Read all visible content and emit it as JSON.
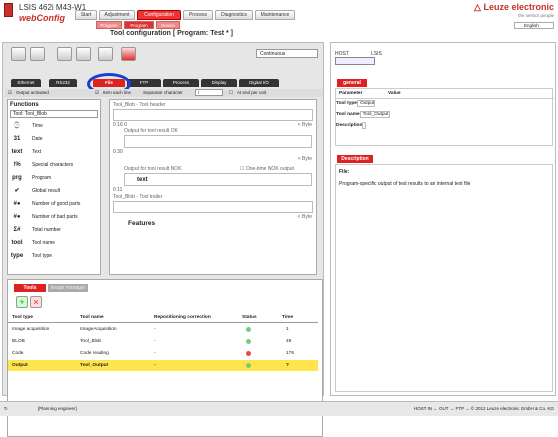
{
  "header": {
    "device": "LSIS 462i M43-W1",
    "app": "webConfig",
    "brand": "△ Leuze electronic",
    "brand_sub": "the sensor people",
    "language": "English",
    "tabs": [
      "Start",
      "Adjustment",
      "Configuration",
      "Process",
      "Diagnostics",
      "Maintenance"
    ],
    "subtabs": [
      "Program",
      "Program",
      "Device"
    ],
    "page_title": "Tool configuration  [ Program: Test * ]"
  },
  "toolbar": {
    "mode": "Continuous"
  },
  "param_tabs": [
    "Ethernet",
    "RS232",
    "File",
    "FTP",
    "Process",
    "Display",
    "Digital I/O"
  ],
  "options": {
    "output_activated": "Output activated",
    "item_each_line": "Item each line",
    "separator_label": "Separator character",
    "separator_value": "/",
    "at_end": "At end per unit"
  },
  "functions": {
    "heading": "Functions",
    "selected": "Tool: Tool_Blob",
    "items": [
      {
        "icon": "⌚",
        "label": "Time"
      },
      {
        "icon": "31",
        "label": "Date"
      },
      {
        "icon": "text",
        "label": "Text"
      },
      {
        "icon": "!%",
        "label": "Special characters"
      },
      {
        "icon": "prg",
        "label": "Program"
      },
      {
        "icon": "✔",
        "label": "Global result"
      },
      {
        "icon": "#●",
        "label": "Number of good parts"
      },
      {
        "icon": "#●",
        "label": "Number of bad parts"
      },
      {
        "icon": "Σ#",
        "label": "Total number"
      },
      {
        "icon": "tool",
        "label": "Tool name"
      },
      {
        "icon": "type",
        "label": "Tool type"
      }
    ]
  },
  "editor": {
    "header_label": "Tool_Blob - Tool header",
    "ok_label": "Output for tool result OK",
    "ok_values": [
      "0",
      "16",
      "0",
      "30"
    ],
    "nok_label": "Output for tool result NOK",
    "nok_option": "One-time NOK output",
    "nok_text": "text",
    "nok_values": [
      "0",
      "11"
    ],
    "trailer_label": "Tool_Blob - Tool trailer",
    "features": "Features",
    "byte": "< Byte"
  },
  "tools": {
    "tabs": [
      "Tools",
      "Image manager"
    ],
    "columns": [
      "Tool type",
      "Tool name",
      "Repositioning correction",
      "Status",
      "Time"
    ],
    "rows": [
      {
        "type": "Image acquisition",
        "name": "ImageAcquisition",
        "repos": "-",
        "status": "#7c7",
        "time": "1"
      },
      {
        "type": "BLOB",
        "name": "Tool_Blob",
        "repos": "-",
        "status": "#7c7",
        "time": "49"
      },
      {
        "type": "Code",
        "name": "Code reading",
        "repos": "-",
        "status": "#e44",
        "time": "176"
      },
      {
        "type": "Output",
        "name": "Tool_Output",
        "repos": "-",
        "status": "#7c7",
        "time": "?"
      }
    ]
  },
  "right": {
    "host": "HOST",
    "lsis": "LSIS",
    "general_tab": "general",
    "param_h": "Parameter",
    "value_h": "Value",
    "props": [
      {
        "k": "Tool type",
        "v": "Output"
      },
      {
        "k": "Tool name",
        "v": "Tool_Output"
      },
      {
        "k": "Description",
        "v": ""
      }
    ],
    "desc_tab": "Description",
    "desc_head": "File:",
    "desc_text": "Program-specific output of test results to an internal text file"
  },
  "status": {
    "user": "[Planning engineer]",
    "right": "HOST IN ← OUT → FTP → © 2012 Leuze electronic GmbH & Co. KG"
  }
}
